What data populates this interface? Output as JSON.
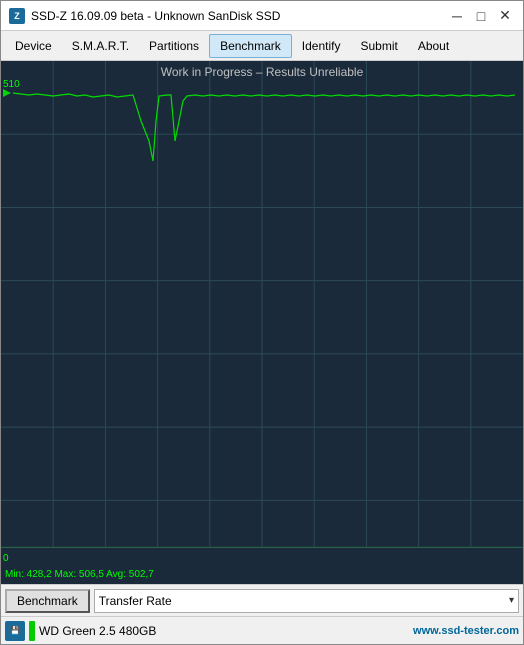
{
  "window": {
    "title": "SSD-Z 16.09.09 beta - Unknown SanDisk SSD",
    "icon_label": "Z"
  },
  "title_controls": {
    "minimize": "─",
    "maximize": "□",
    "close": "✕"
  },
  "menu": {
    "items": [
      {
        "label": "Device",
        "active": false
      },
      {
        "label": "S.M.A.R.T.",
        "active": false
      },
      {
        "label": "Partitions",
        "active": false
      },
      {
        "label": "Benchmark",
        "active": true
      },
      {
        "label": "Identify",
        "active": false
      },
      {
        "label": "Submit",
        "active": false
      },
      {
        "label": "About",
        "active": false
      }
    ]
  },
  "chart": {
    "title": "Work in Progress – Results Unreliable",
    "y_max": "510",
    "y_min": "0",
    "stats": "Min: 428,2  Max: 506,5  Avg: 502,7"
  },
  "bottom": {
    "button_label": "Benchmark",
    "dropdown_value": "Transfer Rate",
    "dropdown_arrow": "▾"
  },
  "statusbar": {
    "device_label": "WD Green 2.5  480GB",
    "website": "www.ssd-tester.com"
  }
}
